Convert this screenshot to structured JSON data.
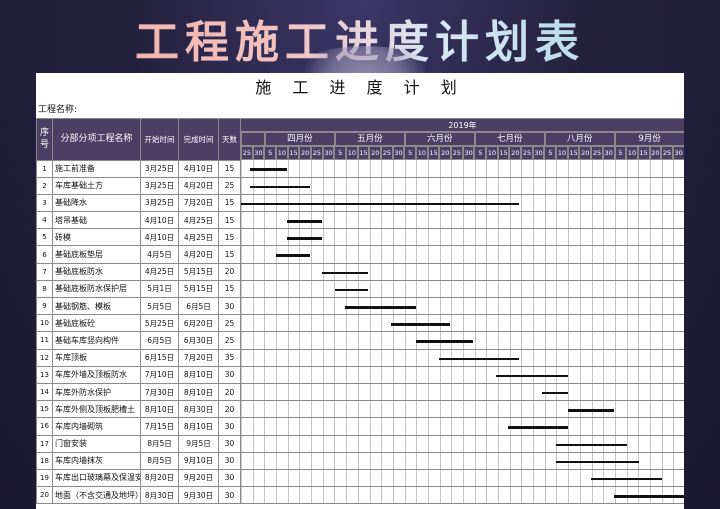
{
  "banner_title": "工程施工进度计划表",
  "sheet": {
    "title": "施 工 进 度 计 划",
    "project_name_label": "工程名称:"
  },
  "table": {
    "headers": {
      "idx": "序号",
      "name": "分部分项工程名称",
      "start": "开始时间",
      "end": "完成时间",
      "days": "天数",
      "year": "2019年"
    },
    "months": [
      "四月份",
      "五月份",
      "六月份",
      "七月份",
      "八月份",
      "9月份"
    ],
    "month_day_ticks": [
      [
        "5",
        "10",
        "15",
        "20",
        "25",
        "30"
      ],
      [
        "5",
        "10",
        "15",
        "20",
        "25",
        "30"
      ],
      [
        "5",
        "10",
        "15",
        "20",
        "25",
        "30"
      ],
      [
        "5",
        "10",
        "15",
        "20",
        "25",
        "30"
      ],
      [
        "5",
        "10",
        "15",
        "20",
        "25",
        "30"
      ],
      [
        "5",
        "10",
        "15",
        "20",
        "25",
        "30"
      ]
    ],
    "pre_ticks": [
      "25",
      "30"
    ],
    "timeline": {
      "start": "2019-03-21",
      "end": "2019-09-30"
    },
    "rows": [
      {
        "idx": "1",
        "name": "施工前准备",
        "start": "3月25日",
        "end": "4月10日",
        "days": "15",
        "bar": [
          "2019-03-25",
          "2019-04-10"
        ]
      },
      {
        "idx": "2",
        "name": "车库基础土方",
        "start": "3月25日",
        "end": "4月20日",
        "days": "25",
        "bar": [
          "2019-03-25",
          "2019-04-20"
        ]
      },
      {
        "idx": "3",
        "name": "基础降水",
        "start": "3月25日",
        "end": "7月20日",
        "days": "15",
        "bar": [
          "2019-03-21",
          "2019-07-20"
        ]
      },
      {
        "idx": "4",
        "name": "塔吊基础",
        "start": "4月10日",
        "end": "4月25日",
        "days": "15",
        "bar": [
          "2019-04-10",
          "2019-04-25"
        ]
      },
      {
        "idx": "5",
        "name": "砖模",
        "start": "4月10日",
        "end": "4月25日",
        "days": "15",
        "bar": [
          "2019-04-10",
          "2019-04-25"
        ]
      },
      {
        "idx": "6",
        "name": "基础底板垫层",
        "start": "4月5日",
        "end": "4月20日",
        "days": "15",
        "bar": [
          "2019-04-05",
          "2019-04-20"
        ]
      },
      {
        "idx": "7",
        "name": "基础底板防水",
        "start": "4月25日",
        "end": "5月15日",
        "days": "20",
        "bar": [
          "2019-04-25",
          "2019-05-15"
        ]
      },
      {
        "idx": "8",
        "name": "基础底板防水保护层",
        "start": "5月1日",
        "end": "5月15日",
        "days": "15",
        "bar": [
          "2019-05-01",
          "2019-05-15"
        ]
      },
      {
        "idx": "9",
        "name": "基础钢筋、模板",
        "start": "5月5日",
        "end": "6月5日",
        "days": "30",
        "bar": [
          "2019-05-05",
          "2019-06-05"
        ]
      },
      {
        "idx": "10",
        "name": "基础底板砼",
        "start": "5月25日",
        "end": "6月20日",
        "days": "25",
        "bar": [
          "2019-05-25",
          "2019-06-20"
        ]
      },
      {
        "idx": "11",
        "name": "基础车库竖向构件",
        "start": "6月5日",
        "end": "6月30日",
        "days": "25",
        "bar": [
          "2019-06-05",
          "2019-06-30"
        ]
      },
      {
        "idx": "12",
        "name": "车库顶板",
        "start": "6月15日",
        "end": "7月20日",
        "days": "35",
        "bar": [
          "2019-06-15",
          "2019-07-20"
        ]
      },
      {
        "idx": "13",
        "name": "车库外墙及顶板防水",
        "start": "7月10日",
        "end": "8月10日",
        "days": "30",
        "bar": [
          "2019-07-10",
          "2019-08-10"
        ]
      },
      {
        "idx": "14",
        "name": "车库外防水保护",
        "start": "7月30日",
        "end": "8月10日",
        "days": "20",
        "bar": [
          "2019-07-30",
          "2019-08-10"
        ]
      },
      {
        "idx": "15",
        "name": "车库外侧及顶板肥槽土",
        "start": "8月10日",
        "end": "8月30日",
        "days": "20",
        "bar": [
          "2019-08-10",
          "2019-08-30"
        ]
      },
      {
        "idx": "16",
        "name": "车库内墙砌筑",
        "start": "7月15日",
        "end": "8月10日",
        "days": "30",
        "bar": [
          "2019-07-15",
          "2019-08-10"
        ]
      },
      {
        "idx": "17",
        "name": "门窗安装",
        "start": "8月5日",
        "end": "9月5日",
        "days": "30",
        "bar": [
          "2019-08-05",
          "2019-09-05"
        ]
      },
      {
        "idx": "18",
        "name": "车库内墙抹灰",
        "start": "8月5日",
        "end": "9月10日",
        "days": "30",
        "bar": [
          "2019-08-05",
          "2019-09-10"
        ]
      },
      {
        "idx": "19",
        "name": "车库出口玻璃幕及保温安装",
        "start": "8月20日",
        "end": "9月20日",
        "days": "30",
        "bar": [
          "2019-08-20",
          "2019-09-20"
        ]
      },
      {
        "idx": "20",
        "name": "地面（不含交通及地坪）",
        "start": "8月30日",
        "end": "9月30日",
        "days": "30",
        "bar": [
          "2019-08-30",
          "2019-09-30"
        ]
      }
    ]
  }
}
